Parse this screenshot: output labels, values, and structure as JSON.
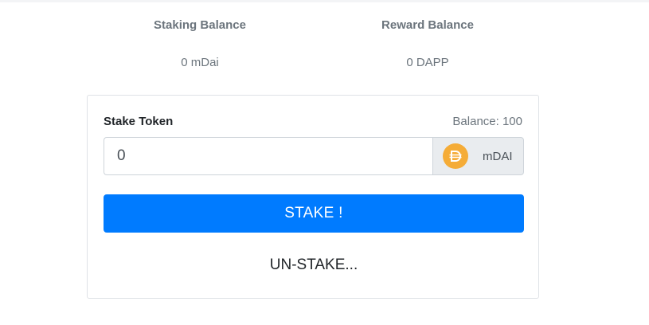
{
  "balances": {
    "staking": {
      "title": "Staking Balance",
      "value": "0 mDai"
    },
    "reward": {
      "title": "Reward Balance",
      "value": "0 DAPP"
    }
  },
  "stake_form": {
    "label": "Stake Token",
    "balance_text": "Balance: 100",
    "amount_value": "0",
    "token_icon": "dai-icon",
    "token_symbol": "mDAI",
    "stake_button": "STAKE !",
    "unstake_button": "UN-STAKE..."
  },
  "colors": {
    "primary": "#007bff",
    "dai": "#f5ac37",
    "muted_text": "#6c757d"
  }
}
